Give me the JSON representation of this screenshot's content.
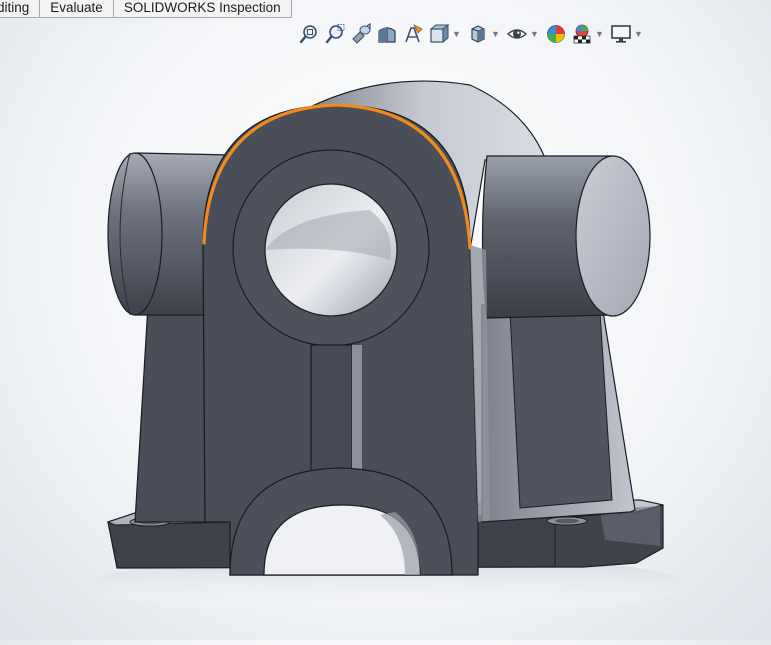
{
  "tabs": [
    {
      "id": "editing",
      "label": "diting"
    },
    {
      "id": "evaluate",
      "label": "Evaluate"
    },
    {
      "id": "inspection",
      "label": "SOLIDWORKS Inspection"
    }
  ],
  "heads_up_toolbar": {
    "items": [
      {
        "id": "zoom-to-fit",
        "icon": "zoom-to-fit-icon"
      },
      {
        "id": "zoom-to-area",
        "icon": "zoom-to-area-icon"
      },
      {
        "id": "previous-view",
        "icon": "previous-view-icon"
      },
      {
        "id": "section-view",
        "icon": "section-view-icon"
      },
      {
        "id": "dynamic-annotation-views",
        "icon": "annotation-view-icon"
      },
      {
        "id": "view-orientation",
        "icon": "view-orientation-icon",
        "dropdown": true
      },
      {
        "id": "display-style",
        "icon": "display-style-icon",
        "dropdown": true
      },
      {
        "id": "hide-show-items",
        "icon": "eye-icon",
        "dropdown": true
      },
      {
        "id": "edit-appearance",
        "icon": "appearance-icon"
      },
      {
        "id": "apply-scene",
        "icon": "scene-icon",
        "dropdown": true
      },
      {
        "id": "view-settings",
        "icon": "monitor-icon",
        "dropdown": true
      }
    ]
  },
  "model": {
    "part": "pillow-block-housing",
    "body_color": "#4a4e57",
    "selected_edge_color": "#f08a1c"
  }
}
